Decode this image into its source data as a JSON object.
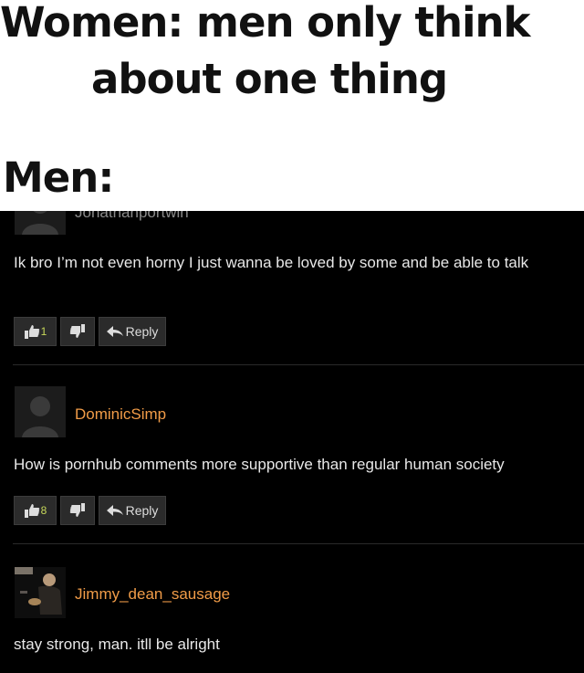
{
  "caption": {
    "line1": "Women: men only think",
    "line2": "about one thing",
    "line3": "Men:"
  },
  "comments": [
    {
      "username": "Jonathanportwin",
      "text": "Ik bro I’m not even horny I just wanna be loved by some and be able to talk",
      "likes": "1",
      "reply_label": "Reply"
    },
    {
      "username": "DominicSimp",
      "text": "How is pornhub comments more supportive than regular human society",
      "likes": "8",
      "reply_label": "Reply"
    },
    {
      "username": "Jimmy_dean_sausage",
      "text": "stay strong, man. itll be alright"
    }
  ],
  "icons": [
    "thumbs-up-icon",
    "thumbs-down-icon",
    "reply-arrow-icon"
  ],
  "colors": {
    "username": "#f19c48",
    "like_count": "#c7d85a",
    "background": "#000000"
  }
}
